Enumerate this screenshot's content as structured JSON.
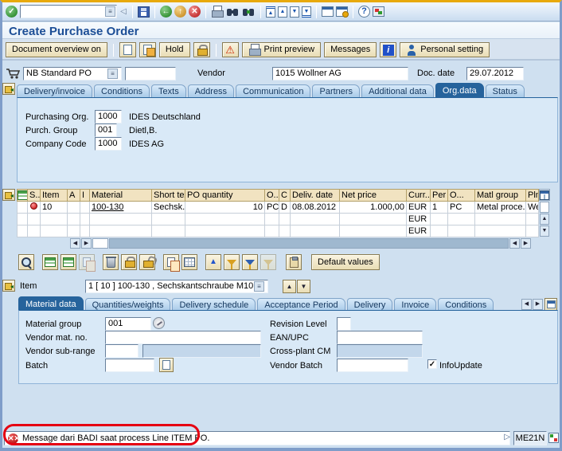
{
  "colors": {
    "accent": "#26639c",
    "beige_button": "#efe6c4",
    "table_header": "#f1e3c1",
    "error_red": "#cc0000",
    "annotation_red": "#e60012",
    "active_tab": "#26639c"
  },
  "system_toolbar": {
    "command_value": ""
  },
  "page_title": "Create Purchase Order",
  "app_toolbar": {
    "document_overview": "Document overview on",
    "hold": "Hold",
    "print_preview": "Print preview",
    "messages": "Messages",
    "personal_setting": "Personal setting"
  },
  "po_header": {
    "order_type": "NB Standard PO",
    "po_number": "",
    "vendor_label": "Vendor",
    "vendor": "1015 Wollner AG",
    "doc_date_label": "Doc. date",
    "doc_date": "29.07.2012",
    "tabs": [
      "Delivery/invoice",
      "Conditions",
      "Texts",
      "Address",
      "Communication",
      "Partners",
      "Additional data",
      "Org.data",
      "Status"
    ],
    "active_tab": "Org.data",
    "org_fields": [
      {
        "label": "Purchasing Org.",
        "value": "1000",
        "text": "IDES Deutschland"
      },
      {
        "label": "Purch. Group",
        "value": "001",
        "text": "Dietl,B."
      },
      {
        "label": "Company Code",
        "value": "1000",
        "text": "IDES AG"
      }
    ]
  },
  "item_table": {
    "columns": {
      "s": "S...",
      "item": "Item",
      "a": "A",
      "i": "I",
      "material": "Material",
      "short_text": "Short text",
      "po_quantity": "PO quantity",
      "oun": "O...",
      "c": "C",
      "deliv_date": "Deliv. date",
      "net_price": "Net price",
      "curr": "Curr...",
      "per": "Per",
      "opu": "O...",
      "matl_group": "Matl group",
      "pln": "Pln"
    },
    "rows": [
      {
        "item": "10",
        "a": "",
        "i": "",
        "material": "100-130",
        "short_text": "Sechsk...",
        "po_quantity": "10",
        "oun": "PC",
        "c": "D",
        "deliv_date": "08.08.2012",
        "net_price": "1.000,00",
        "curr": "EUR",
        "per": "1",
        "opu": "PC",
        "matl_group": "Metal proce...",
        "pln": "We"
      },
      {
        "item": "",
        "a": "",
        "i": "",
        "material": "",
        "short_text": "",
        "po_quantity": "",
        "oun": "",
        "c": "",
        "deliv_date": "",
        "net_price": "",
        "curr": "EUR",
        "per": "",
        "opu": "",
        "matl_group": "",
        "pln": ""
      },
      {
        "item": "",
        "a": "",
        "i": "",
        "material": "",
        "short_text": "",
        "po_quantity": "",
        "oun": "",
        "c": "",
        "deliv_date": "",
        "net_price": "",
        "curr": "EUR",
        "per": "",
        "opu": "",
        "matl_group": "",
        "pln": ""
      }
    ],
    "default_values": "Default values"
  },
  "item_detail": {
    "item_label": "Item",
    "item_selector": "1 [ 10 ] 100-130 , Sechskantschraube M10",
    "tabs": [
      "Material data",
      "Quantities/weights",
      "Delivery schedule",
      "Acceptance Period",
      "Delivery",
      "Invoice",
      "Conditions"
    ],
    "active_tab": "Material data",
    "material_group_label": "Material group",
    "material_group": "001",
    "vendor_mat_label": "Vendor mat. no.",
    "vendor_mat": "",
    "vendor_subrange_label": "Vendor sub-range",
    "vendor_subrange": "",
    "batch_label": "Batch",
    "batch": "",
    "revision_label": "Revision Level",
    "revision": "",
    "ean_label": "EAN/UPC",
    "ean": "",
    "crossplant_label": "Cross-plant CM",
    "crossplant": "",
    "vendor_batch_label": "Vendor Batch",
    "vendor_batch": "",
    "info_update_label": "InfoUpdate",
    "info_update_checked": true
  },
  "status_bar": {
    "message": "Message dari BADI saat process Line ITEM PO.",
    "transaction": "ME21N"
  }
}
